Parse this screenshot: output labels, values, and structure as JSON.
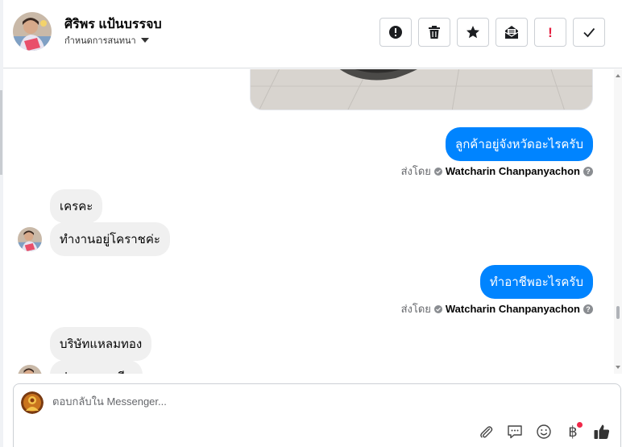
{
  "header": {
    "contact_name": "ศิริพร แป้นบรรจบ",
    "status_label": "กำหนดการสนทนา",
    "actions": [
      {
        "name": "spam-report-button",
        "icon": "exclamation-circle-icon"
      },
      {
        "name": "delete-button",
        "icon": "trash-icon"
      },
      {
        "name": "star-button",
        "icon": "star-icon"
      },
      {
        "name": "mark-unread-button",
        "icon": "envelope-open-icon"
      },
      {
        "name": "follow-up-button",
        "icon": "red-exclamation-icon",
        "glyph": "!"
      },
      {
        "name": "mark-done-button",
        "icon": "checkmark-icon"
      }
    ]
  },
  "conversation": {
    "messages": [
      {
        "direction": "out",
        "text": "ลูกค้าอยู่จังหวัดอะไรครับ"
      },
      {
        "direction": "out_meta",
        "sent_by_label": "ส่งโดย",
        "agent": "Watcharin Chanpanyachon",
        "help": "?"
      },
      {
        "direction": "in",
        "text": "เครคะ"
      },
      {
        "direction": "in",
        "text": "ทำงานอยู่โคราชค่ะ"
      },
      {
        "direction": "out",
        "text": "ทำอาชีพอะไรครับ"
      },
      {
        "direction": "out_meta",
        "sent_by_label": "ส่งโดย",
        "agent": "Watcharin Chanpanyachon",
        "help": "?"
      },
      {
        "direction": "in",
        "text": "บริษัทแหลมทอง"
      },
      {
        "direction": "in",
        "text": "ประกอบอาชีพ"
      }
    ]
  },
  "composer": {
    "placeholder": "ตอบกลับใน Messenger...",
    "tools": [
      "paperclip-icon",
      "saved-reply-icon",
      "emoji-icon",
      "baht-payment-icon",
      "thumbs-up-icon"
    ],
    "baht_glyph": "฿"
  },
  "colors": {
    "outgoing_bubble": "#0084ff",
    "incoming_bubble": "#f0f0f0",
    "notification_dot": "#f02849",
    "follow_up_red": "#e41e3f"
  }
}
